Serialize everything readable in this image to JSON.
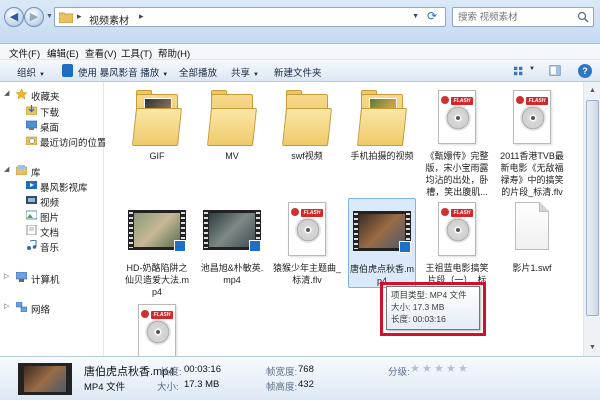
{
  "address": {
    "crumb": "视频素材",
    "search_placeholder": "搜索 视频素材"
  },
  "menu": {
    "file": "文件(F)",
    "edit": "编辑(E)",
    "view": "查看(V)",
    "tools": "工具(T)",
    "help": "帮助(H)"
  },
  "toolbar": {
    "organize": "组织",
    "play_with": "使用 暴风影音 播放",
    "play_all": "全部播放",
    "share": "共享",
    "new_folder": "新建文件夹"
  },
  "nav": {
    "favorites": "收藏夹",
    "downloads": "下载",
    "desktop": "桌面",
    "recent": "最近访问的位置",
    "libraries": "库",
    "baofeng": "暴风影视库",
    "videos": "视频",
    "pictures": "图片",
    "documents": "文档",
    "music": "音乐",
    "computer": "计算机",
    "network": "网络"
  },
  "files": {
    "f1": "GIF",
    "f2": "MV",
    "f3": "swf视频",
    "f4": "手机拍摄的视频",
    "f5": "《甄嬛传》完整版，宋小宝雨露均沾的出处，卧槽，笑出腹肌...",
    "f6": "2011香港TVB最新电影《无敌福禄寿》中的搞笑的片段_标清.flv",
    "f7": "HD-奶酪陷阱之仙贝造爱大法.mp4",
    "f8": "池昌旭&朴敏英.mp4",
    "f9": "猿猴少年主题曲_标清.flv",
    "f10": "唐伯虎点秋香.mp4",
    "f11": "王祖蓝电影搞笑片段（一）_标清.",
    "f12": "影片1.swf"
  },
  "tooltip": {
    "type": "项目类型: MP4 文件",
    "size": "大小: 17.3 MB",
    "length": "长度: 00:03:16"
  },
  "details": {
    "name": "唐伯虎点秋香.mp4",
    "type": "MP4 文件",
    "length_label": "长度:",
    "length_value": "00:03:16",
    "size_label": "大小:",
    "size_value": "17.3 MB",
    "width_label": "帧宽度:",
    "width_value": "768",
    "height_label": "帧高度:",
    "height_value": "432",
    "rating_label": "分级:"
  },
  "colors": {
    "accent": "#1f6fc8",
    "flash_red": "#d3292c",
    "highlight_box": "#d1102d",
    "selection": "#dbeafb"
  }
}
